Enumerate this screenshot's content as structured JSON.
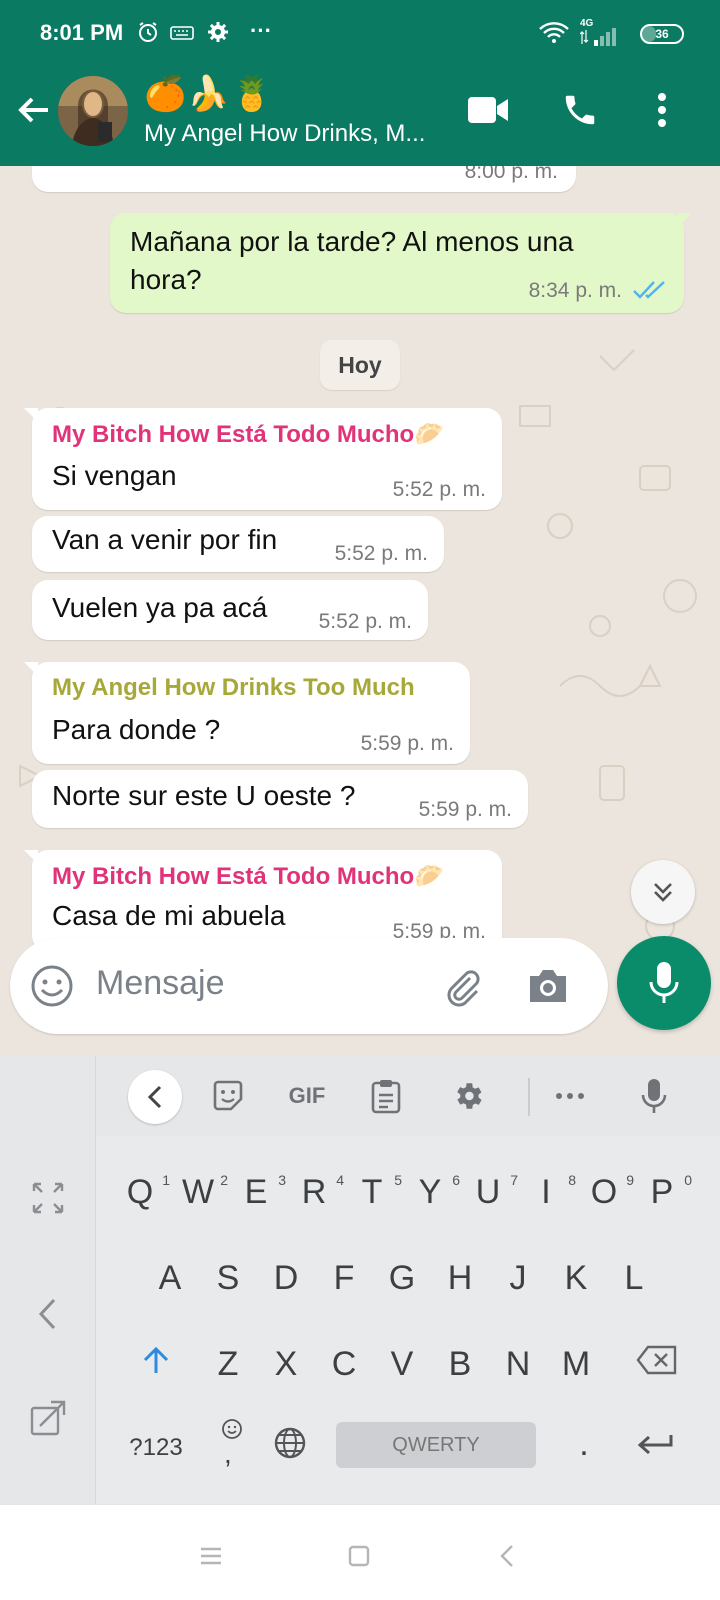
{
  "status_bar": {
    "time": "8:01 PM",
    "network": "4G",
    "battery": "36",
    "battery_level": 0.36
  },
  "app_bar": {
    "contact_emoji": "🍊🍌🍍",
    "contact_name": "My Angel How Drinks, M...",
    "icons": [
      "back-arrow-icon",
      "video-call-icon",
      "phone-icon",
      "more-options-icon"
    ]
  },
  "chat": {
    "date_chip": "Hoy",
    "messages": [
      {
        "direction": "in",
        "text": "",
        "time": "8:00 p. m."
      },
      {
        "direction": "out",
        "text": "Mañana por la tarde? Al menos una hora?",
        "time": "8:34 p. m.",
        "status": "read"
      },
      {
        "direction": "in",
        "sender": "My Bitch How Está Todo Mucho🥟",
        "sender_color": "#e0337a",
        "text": "Si vengan",
        "time": "5:52 p. m."
      },
      {
        "direction": "in",
        "text": "Van a venir por fin",
        "time": "5:52 p. m."
      },
      {
        "direction": "in",
        "text": "Vuelen ya pa acá",
        "time": "5:52 p. m."
      },
      {
        "direction": "in",
        "sender": "My Angel How Drinks Too Much",
        "sender_color": "#a7a83a",
        "text": "Para donde ?",
        "time": "5:59 p. m."
      },
      {
        "direction": "in",
        "text": "Norte sur este U oeste ?",
        "time": "5:59 p. m."
      },
      {
        "direction": "in",
        "sender": "My Bitch How Está Todo Mucho🥟",
        "sender_color": "#e0337a",
        "text": "Casa de mi abuela",
        "time": "5:59 p. m."
      }
    ]
  },
  "input": {
    "placeholder": "Mensaje"
  },
  "keyboard": {
    "toolbar": [
      "back-icon",
      "sticker-icon",
      "GIF",
      "clipboard-icon",
      "settings-icon",
      "more-icon",
      "mic-icon"
    ],
    "gif_label": "GIF",
    "row1": [
      "Q",
      "W",
      "E",
      "R",
      "T",
      "Y",
      "U",
      "I",
      "O",
      "P"
    ],
    "row1_hints": [
      "1",
      "2",
      "3",
      "4",
      "5",
      "6",
      "7",
      "8",
      "9",
      "0"
    ],
    "row2": [
      "A",
      "S",
      "D",
      "F",
      "G",
      "H",
      "J",
      "K",
      "L"
    ],
    "row3": [
      "Z",
      "X",
      "C",
      "V",
      "B",
      "N",
      "M"
    ],
    "symbols_key": "?123",
    "emoji_comma": ",",
    "space_label": "QWERTY",
    "period_key": "."
  },
  "colors": {
    "header": "#0a7a62",
    "fab": "#0a8c6b",
    "outgoing_bubble": "#e2f8c8",
    "read_ticks": "#4fb3f0"
  }
}
